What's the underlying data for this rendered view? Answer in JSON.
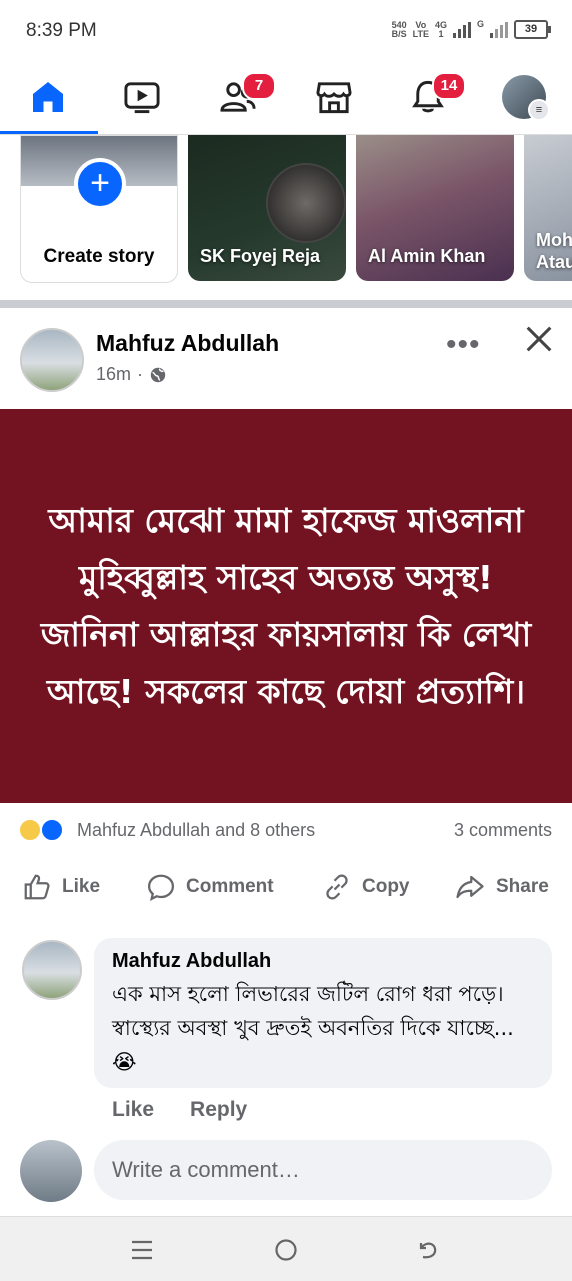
{
  "status_bar": {
    "time": "8:39 PM",
    "net_speed": "540",
    "net_unit": "B/S",
    "volte_top": "Vo",
    "volte_bottom": "LTE",
    "network_top": "4G",
    "network_bottom": "1",
    "network2": "G",
    "battery": "39"
  },
  "top_nav": {
    "friends_badge": "7",
    "notifications_badge": "14"
  },
  "stories": {
    "create_label": "Create story",
    "items": [
      {
        "name": "SK Foyej Reja"
      },
      {
        "name": "Al Amin Khan"
      },
      {
        "name": "Moh Atau"
      }
    ]
  },
  "post": {
    "author": "Mahfuz Abdullah",
    "time": "16m",
    "separator": "·",
    "more": "•••",
    "body": "আমার মেঝো মামা হাফেজ মাওলানা মুহিব্বুল্লাহ সাহেব অত্যন্ত অসুস্থ! জানিনা আল্লাহর ফায়সালায় কি লেখা আছে! সকলের কাছে দোয়া প্রত্যাশি।",
    "background_color": "#731321",
    "reactions_text": "Mahfuz Abdullah and 8 others",
    "comments_count": "3 comments",
    "actions": {
      "like": "Like",
      "comment": "Comment",
      "copy": "Copy",
      "share": "Share"
    }
  },
  "comment": {
    "author": "Mahfuz Abdullah",
    "text": "এক মাস হলো লিভারের জটিল রোগ ধরা পড়ে। স্বাস্থ্যের অবস্থা খুব দ্রুতই অবনতির দিকে যাচ্ছে... 😭",
    "like": "Like",
    "reply": "Reply"
  },
  "write_comment": {
    "placeholder": "Write a comment…"
  },
  "colors": {
    "accent": "#0866ff",
    "badge": "#e41e3f"
  },
  "icons": [
    "home-icon",
    "video-icon",
    "friends-icon",
    "marketplace-icon",
    "bell-icon",
    "globe-icon",
    "close-icon",
    "like-icon",
    "comment-icon",
    "copy-icon",
    "share-icon",
    "menu-icon",
    "home-circle-icon",
    "back-icon"
  ]
}
